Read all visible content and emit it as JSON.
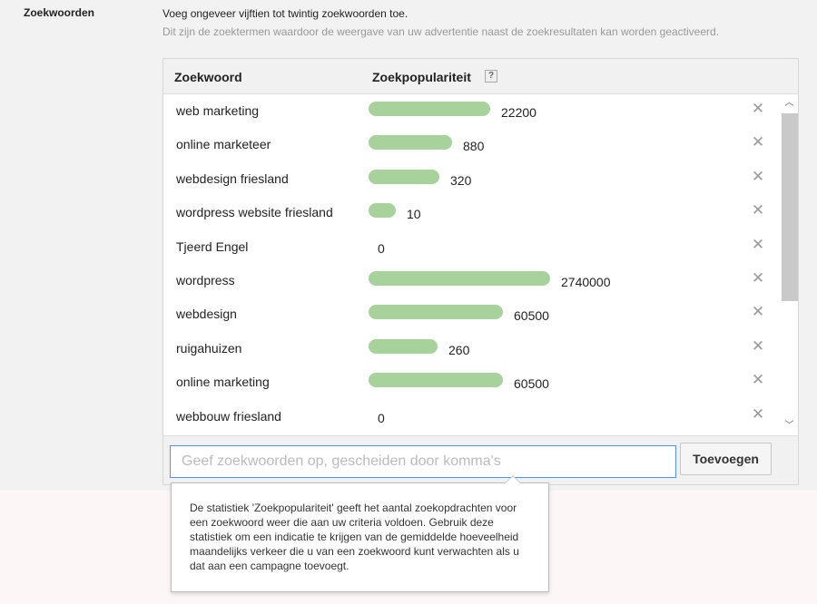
{
  "section": {
    "label": "Zoekwoorden",
    "intro": "Voeg ongeveer vijftien tot twintig zoekwoorden toe.",
    "hint": "Dit zijn de zoektermen waardoor de weergave van uw advertentie naast de zoekresultaten kan worden geactiveerd."
  },
  "table": {
    "col_keyword": "Zoekwoord",
    "col_popularity": "Zoekpopulariteit",
    "help_icon_text": "?",
    "bar_color": "#a8d29c",
    "rows": [
      {
        "keyword": "web marketing",
        "popularity": "22200",
        "bar_fraction": 0.67
      },
      {
        "keyword": "online marketeer",
        "popularity": "880",
        "bar_fraction": 0.46
      },
      {
        "keyword": "webdesign friesland",
        "popularity": "320",
        "bar_fraction": 0.39
      },
      {
        "keyword": "wordpress website friesland",
        "popularity": "10",
        "bar_fraction": 0.15
      },
      {
        "keyword": "Tjeerd Engel",
        "popularity": "0",
        "bar_fraction": 0
      },
      {
        "keyword": "wordpress",
        "popularity": "2740000",
        "bar_fraction": 1.0
      },
      {
        "keyword": "webdesign",
        "popularity": "60500",
        "bar_fraction": 0.74
      },
      {
        "keyword": "ruigahuizen",
        "popularity": "260",
        "bar_fraction": 0.38
      },
      {
        "keyword": "online marketing",
        "popularity": "60500",
        "bar_fraction": 0.74
      },
      {
        "keyword": "webbouw friesland",
        "popularity": "0",
        "bar_fraction": 0
      }
    ],
    "remove_icon": "close-icon",
    "remove_glyph": "✕"
  },
  "scrollbar": {
    "up_glyph": "︿",
    "down_glyph": "﹀"
  },
  "input": {
    "placeholder": "Geef zoekwoorden op, gescheiden door komma's",
    "value": ""
  },
  "add_button": {
    "label": "Toevoegen"
  },
  "tooltip": {
    "text": "De statistiek 'Zoekpopulariteit' geeft het aantal zoekopdrachten voor een zoekwoord weer die aan uw criteria voldoen. Gebruik deze statistiek om een indicatie te krijgen van de gemiddelde hoeveelheid maandelijks verkeer die u van een zoekwoord kunt verwachten als u dat aan een campagne toevoegt."
  }
}
